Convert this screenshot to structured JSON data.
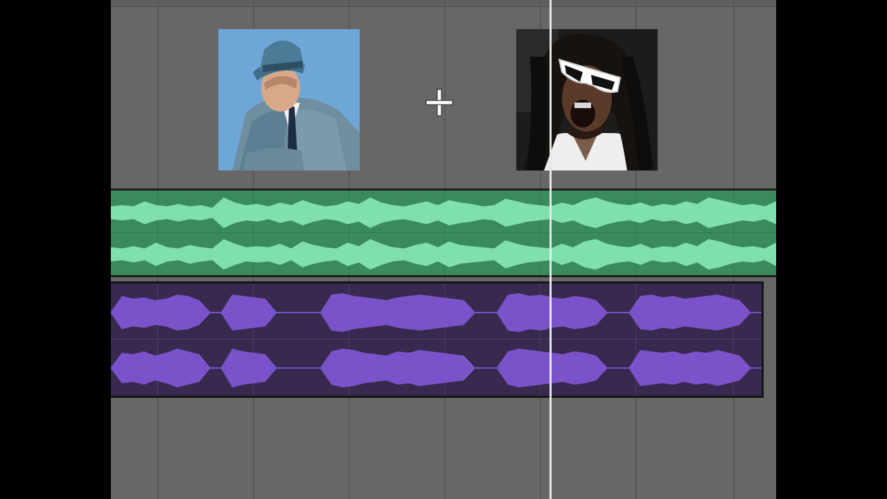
{
  "colors": {
    "workspace": "#676767",
    "grid": "#575757",
    "green_track": "#3a8a5c",
    "green_wave": "#7fe0ae",
    "purple_track": "#372a4e",
    "purple_wave": "#7a52c9",
    "playhead": "#e8e8e8"
  },
  "icons": {
    "plus": "plus-icon"
  },
  "tracks": {
    "green": {
      "channels": [
        {
          "envelope": [
            5,
            6,
            5,
            9,
            6,
            5,
            7,
            5,
            6,
            4,
            12,
            8,
            6,
            7,
            5,
            8,
            6,
            10,
            7,
            5,
            6,
            9,
            7,
            12,
            8,
            6,
            5,
            7,
            9,
            6,
            10,
            8,
            7,
            5,
            6,
            11,
            9,
            7,
            6,
            5,
            8,
            6,
            10,
            12,
            9,
            7,
            6,
            8,
            5,
            7,
            6,
            9,
            7,
            12,
            10,
            8,
            6,
            7,
            5,
            9
          ]
        },
        {
          "envelope": [
            6,
            5,
            7,
            5,
            10,
            6,
            5,
            8,
            6,
            5,
            13,
            9,
            6,
            7,
            6,
            9,
            5,
            11,
            8,
            6,
            5,
            10,
            7,
            13,
            9,
            6,
            5,
            8,
            10,
            6,
            11,
            8,
            7,
            6,
            5,
            12,
            9,
            7,
            6,
            5,
            9,
            6,
            11,
            13,
            9,
            7,
            6,
            9,
            5,
            7,
            6,
            10,
            7,
            13,
            11,
            8,
            6,
            7,
            5,
            10
          ]
        }
      ]
    },
    "purple": {
      "channels": [
        {
          "envelope": [
            0.5,
            12,
            10,
            11,
            9,
            10,
            13,
            12,
            9,
            0.5,
            0.5,
            13,
            12,
            11,
            10,
            0.5,
            0.5,
            0.5,
            0.5,
            0.5,
            13,
            14,
            12,
            11,
            10,
            9,
            11,
            12,
            13,
            12,
            11,
            10,
            9,
            0.5,
            0.5,
            0.5,
            13,
            14,
            12,
            13,
            11,
            10,
            12,
            11,
            9,
            0.5,
            0.5,
            0.5,
            12,
            13,
            11,
            12,
            10,
            11,
            12,
            13,
            11,
            9,
            0.5,
            0.5
          ]
        },
        {
          "envelope": [
            0.5,
            11,
            10,
            12,
            9,
            11,
            14,
            12,
            10,
            0.5,
            0.5,
            14,
            12,
            11,
            10,
            0.5,
            0.5,
            0.5,
            0.5,
            0.5,
            12,
            14,
            13,
            11,
            10,
            9,
            12,
            11,
            13,
            12,
            11,
            10,
            9,
            0.5,
            0.5,
            0.5,
            12,
            14,
            13,
            12,
            11,
            10,
            12,
            11,
            9,
            0.5,
            0.5,
            0.5,
            13,
            12,
            11,
            12,
            10,
            12,
            11,
            13,
            11,
            9,
            0.5,
            0.5
          ]
        }
      ]
    }
  }
}
